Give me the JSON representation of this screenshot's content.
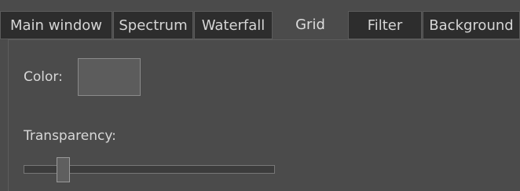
{
  "tabs": [
    {
      "label": "Main window",
      "active": false
    },
    {
      "label": "Spectrum",
      "active": false
    },
    {
      "label": "Waterfall",
      "active": false
    },
    {
      "label": "Grid",
      "active": true
    },
    {
      "label": "Filter",
      "active": false
    },
    {
      "label": "Background",
      "active": false
    }
  ],
  "grid": {
    "color_label": "Color:",
    "color_value": "#5c5c5c",
    "transparency_label": "Transparency:",
    "transparency_level": 0.14
  },
  "colors": {
    "background": "#4b4b4b",
    "inactive_tab": "#2d2d2d",
    "text": "#d8d8d8"
  }
}
